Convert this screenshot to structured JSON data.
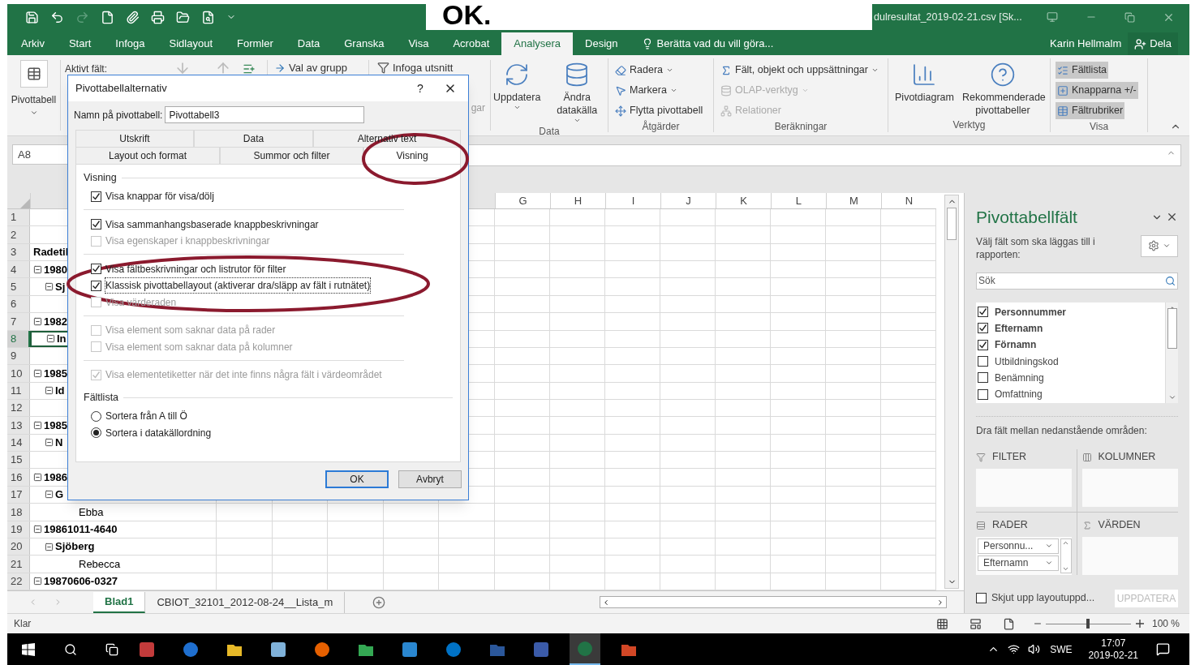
{
  "title_bar": {
    "title": "dulresultat_2019-02-21.csv  [Sk...",
    "overlay_text": "OK."
  },
  "menu_tabs": [
    {
      "label": "Arkiv",
      "selected": false
    },
    {
      "label": "Start",
      "selected": false
    },
    {
      "label": "Infoga",
      "selected": false
    },
    {
      "label": "Sidlayout",
      "selected": false
    },
    {
      "label": "Formler",
      "selected": false
    },
    {
      "label": "Data",
      "selected": false
    },
    {
      "label": "Granska",
      "selected": false
    },
    {
      "label": "Visa",
      "selected": false
    },
    {
      "label": "Acrobat",
      "selected": false
    },
    {
      "label": "Analysera",
      "selected": true
    },
    {
      "label": "Design",
      "selected": false
    }
  ],
  "tell_me": "Berätta vad du vill göra...",
  "user": "Karin Hellmalm",
  "share_button": "Dela",
  "ribbon": {
    "pivot_button": "Pivottabell",
    "active_field_label": "Aktivt fält:",
    "group_selection": "Val av grupp",
    "insert_slicer": "Infoga utsnitt",
    "cut_label": "gar",
    "groups": [
      {
        "label": "Data",
        "kind": "large",
        "items": [
          {
            "label": "Uppdatera",
            "dropdown": true,
            "disabled": false,
            "selected": false
          },
          {
            "label": "Ändra datakälla",
            "dropdown": true,
            "disabled": false,
            "selected": false
          }
        ]
      },
      {
        "label": "Åtgärder",
        "kind": "small",
        "items": [
          {
            "label": "Radera",
            "dropdown": true,
            "disabled": false,
            "selected": false
          },
          {
            "label": "Markera",
            "dropdown": true,
            "disabled": false,
            "selected": false
          },
          {
            "label": "Flytta pivottabell",
            "dropdown": false,
            "disabled": false,
            "selected": false
          }
        ]
      },
      {
        "label": "Beräkningar",
        "kind": "small",
        "items": [
          {
            "label": "Fält, objekt och uppsättningar",
            "dropdown": true,
            "disabled": false,
            "selected": false
          },
          {
            "label": "OLAP-verktyg",
            "dropdown": true,
            "disabled": true,
            "selected": false
          },
          {
            "label": "Relationer",
            "dropdown": false,
            "disabled": true,
            "selected": false
          }
        ]
      },
      {
        "label": "Verktyg",
        "kind": "large",
        "items": [
          {
            "label": "Pivotdiagram",
            "dropdown": false,
            "disabled": false,
            "selected": false
          },
          {
            "label": "Rekommenderade pivottabeller",
            "dropdown": false,
            "disabled": false,
            "selected": false
          }
        ]
      },
      {
        "label": "Visa",
        "kind": "small",
        "items": [
          {
            "label": "Fältlista",
            "dropdown": false,
            "disabled": false,
            "selected": true
          },
          {
            "label": "Knapparna +/-",
            "dropdown": false,
            "disabled": false,
            "selected": true
          },
          {
            "label": "Fältrubriker",
            "dropdown": false,
            "disabled": false,
            "selected": true
          }
        ]
      }
    ]
  },
  "formula_bar": {
    "name_box": "A8"
  },
  "sheet": {
    "columns": [
      {
        "label": "G"
      },
      {
        "label": "H"
      },
      {
        "label": "I"
      },
      {
        "label": "J"
      },
      {
        "label": "K"
      },
      {
        "label": "L"
      },
      {
        "label": "M"
      },
      {
        "label": "N"
      }
    ],
    "top_rows": [
      {
        "row_number": "1",
        "selected": false
      },
      {
        "row_number": "2",
        "selected": false
      },
      {
        "row_number": "3",
        "text": "Radetil",
        "selected": false
      }
    ],
    "pivot_rows": [
      {
        "row_number": "4",
        "text": "1980",
        "expanded": true,
        "selected": false,
        "children": [
          {
            "row_number": "5",
            "text": "Sj",
            "expanded": true,
            "selected": false,
            "children": [
              {
                "row_number": "6",
                "selected": false
              }
            ]
          }
        ]
      },
      {
        "row_number": "7",
        "text": "1982",
        "expanded": true,
        "selected": false,
        "children": [
          {
            "row_number": "8",
            "text": "In",
            "expanded": true,
            "selected": true,
            "children": [
              {
                "row_number": "9",
                "selected": false
              }
            ]
          }
        ]
      },
      {
        "row_number": "10",
        "text": "1985",
        "expanded": true,
        "selected": false,
        "children": [
          {
            "row_number": "11",
            "text": "Id",
            "expanded": true,
            "selected": false,
            "children": [
              {
                "row_number": "12",
                "selected": false
              }
            ]
          }
        ]
      },
      {
        "row_number": "13",
        "text": "1985",
        "expanded": true,
        "selected": false,
        "children": [
          {
            "row_number": "14",
            "text": "N",
            "expanded": true,
            "selected": false,
            "children": [
              {
                "row_number": "15",
                "selected": false
              }
            ]
          }
        ]
      },
      {
        "row_number": "16",
        "text": "1986",
        "expanded": true,
        "selected": false,
        "children": [
          {
            "row_number": "17",
            "text": "G",
            "expanded": true,
            "selected": false,
            "children": [
              {
                "row_number": "18",
                "text": "Ebba",
                "selected": false
              }
            ]
          }
        ]
      },
      {
        "row_number": "19",
        "text": "19861011-4640",
        "expanded": true,
        "selected": false,
        "children": [
          {
            "row_number": "20",
            "text": "Sjöberg",
            "expanded": true,
            "selected": false,
            "children": [
              {
                "row_number": "21",
                "text": "Rebecca",
                "selected": false
              }
            ]
          }
        ]
      },
      {
        "row_number": "22",
        "text": "19870606-0327",
        "expanded": true,
        "selected": false
      }
    ],
    "sheet_tabs": [
      {
        "label": "Blad1",
        "selected": true
      },
      {
        "label": "CBIOT_32101_2012-08-24__Lista_m",
        "selected": false
      }
    ]
  },
  "status_bar": {
    "text": "Klar",
    "zoom": "100 %",
    "zoom_slider": {
      "level": 0.5
    }
  },
  "field_pane": {
    "title": "Pivottabellfält",
    "instruction": "Välj fält som ska läggas till i rapporten:",
    "search_placeholder": "Sök",
    "fields": [
      {
        "label": "Personnummer",
        "checked": true
      },
      {
        "label": "Efternamn",
        "checked": true
      },
      {
        "label": "Förnamn",
        "checked": true
      },
      {
        "label": "Utbildningskod",
        "checked": false
      },
      {
        "label": "Benämning",
        "checked": false
      },
      {
        "label": "Omfattning",
        "checked": false
      }
    ],
    "areas_hint": "Dra fält mellan nedanstående områden:",
    "areas": [
      {
        "label": "FILTER",
        "kind": "filter"
      },
      {
        "label": "KOLUMNER",
        "kind": "columns"
      },
      {
        "label": "RADER",
        "kind": "rows",
        "items": [
          "Personnu...",
          "Efternamn"
        ]
      },
      {
        "label": "VÄRDEN",
        "kind": "values"
      }
    ],
    "defer": {
      "label": "Skjut upp layoutuppd...",
      "checked": false
    },
    "update_button": {
      "label": "UPPDATERA",
      "disabled": true
    }
  },
  "dialog": {
    "title": "Pivottabellalternativ",
    "help": "?",
    "name_label": "Namn på pivottabell:",
    "name_value": "Pivottabell3",
    "tab_rows": [
      {
        "tabs": [
          {
            "label": "Utskrift",
            "selected": false
          },
          {
            "label": "Data",
            "selected": false
          },
          {
            "label": "Alternativ text",
            "selected": false
          }
        ]
      },
      {
        "tabs": [
          {
            "label": "Layout och format",
            "selected": false
          },
          {
            "label": "Summor och filter",
            "selected": false
          },
          {
            "label": "Visning",
            "selected": true
          }
        ]
      }
    ],
    "sections": [
      {
        "title": "Visning",
        "groups": [
          {
            "options": [
              {
                "kind": "checkbox",
                "label": "Visa knappar för visa/dölj",
                "checked": true,
                "disabled": false,
                "focused": false
              }
            ]
          },
          {
            "options": [
              {
                "kind": "checkbox",
                "label": "Visa sammanhangsbaserade knappbeskrivningar",
                "checked": true,
                "disabled": false,
                "focused": false
              },
              {
                "kind": "checkbox",
                "label": "Visa egenskaper i knappbeskrivningar",
                "checked": false,
                "disabled": true,
                "focused": false
              }
            ]
          },
          {
            "options": [
              {
                "kind": "checkbox",
                "label": "Visa fältbeskrivningar och listrutor för filter",
                "checked": true,
                "disabled": false,
                "focused": false
              },
              {
                "kind": "checkbox",
                "label": "Klassisk pivottabellayout (aktiverar dra/släpp av fält i rutnätet)",
                "checked": true,
                "disabled": false,
                "focused": true
              },
              {
                "kind": "checkbox",
                "label": "Visa värderaden",
                "checked": false,
                "disabled": true,
                "focused": false
              }
            ]
          },
          {
            "options": [
              {
                "kind": "checkbox",
                "label": "Visa element som saknar data på rader",
                "checked": false,
                "disabled": true,
                "focused": false
              },
              {
                "kind": "checkbox",
                "label": "Visa element som saknar data på kolumner",
                "checked": false,
                "disabled": true,
                "focused": false
              }
            ]
          },
          {
            "options": [
              {
                "kind": "checkbox",
                "label": "Visa elementetiketter när det inte finns några fält i värdeområdet",
                "checked": true,
                "disabled": true,
                "focused": false
              }
            ]
          }
        ]
      },
      {
        "title": "Fältlista",
        "groups": [
          {
            "options": [
              {
                "kind": "radio",
                "label": "Sortera från A till Ö",
                "checked": false,
                "disabled": false,
                "focused": false
              },
              {
                "kind": "radio",
                "label": "Sortera i datakällordning",
                "checked": true,
                "disabled": false,
                "focused": false
              }
            ]
          }
        ]
      }
    ],
    "buttons": [
      {
        "label": "OK",
        "default": true
      },
      {
        "label": "Avbryt",
        "default": false
      }
    ]
  },
  "taskbar": {
    "apps": [
      {
        "selected": false
      },
      {
        "selected": false
      },
      {
        "selected": false
      },
      {
        "selected": false
      },
      {
        "selected": false
      },
      {
        "selected": false
      },
      {
        "selected": false
      },
      {
        "selected": false
      },
      {
        "selected": false
      },
      {
        "selected": false
      },
      {
        "selected": true
      },
      {
        "selected": false
      }
    ],
    "language": "SWE",
    "time": "17:07",
    "date": "2019-02-21"
  }
}
